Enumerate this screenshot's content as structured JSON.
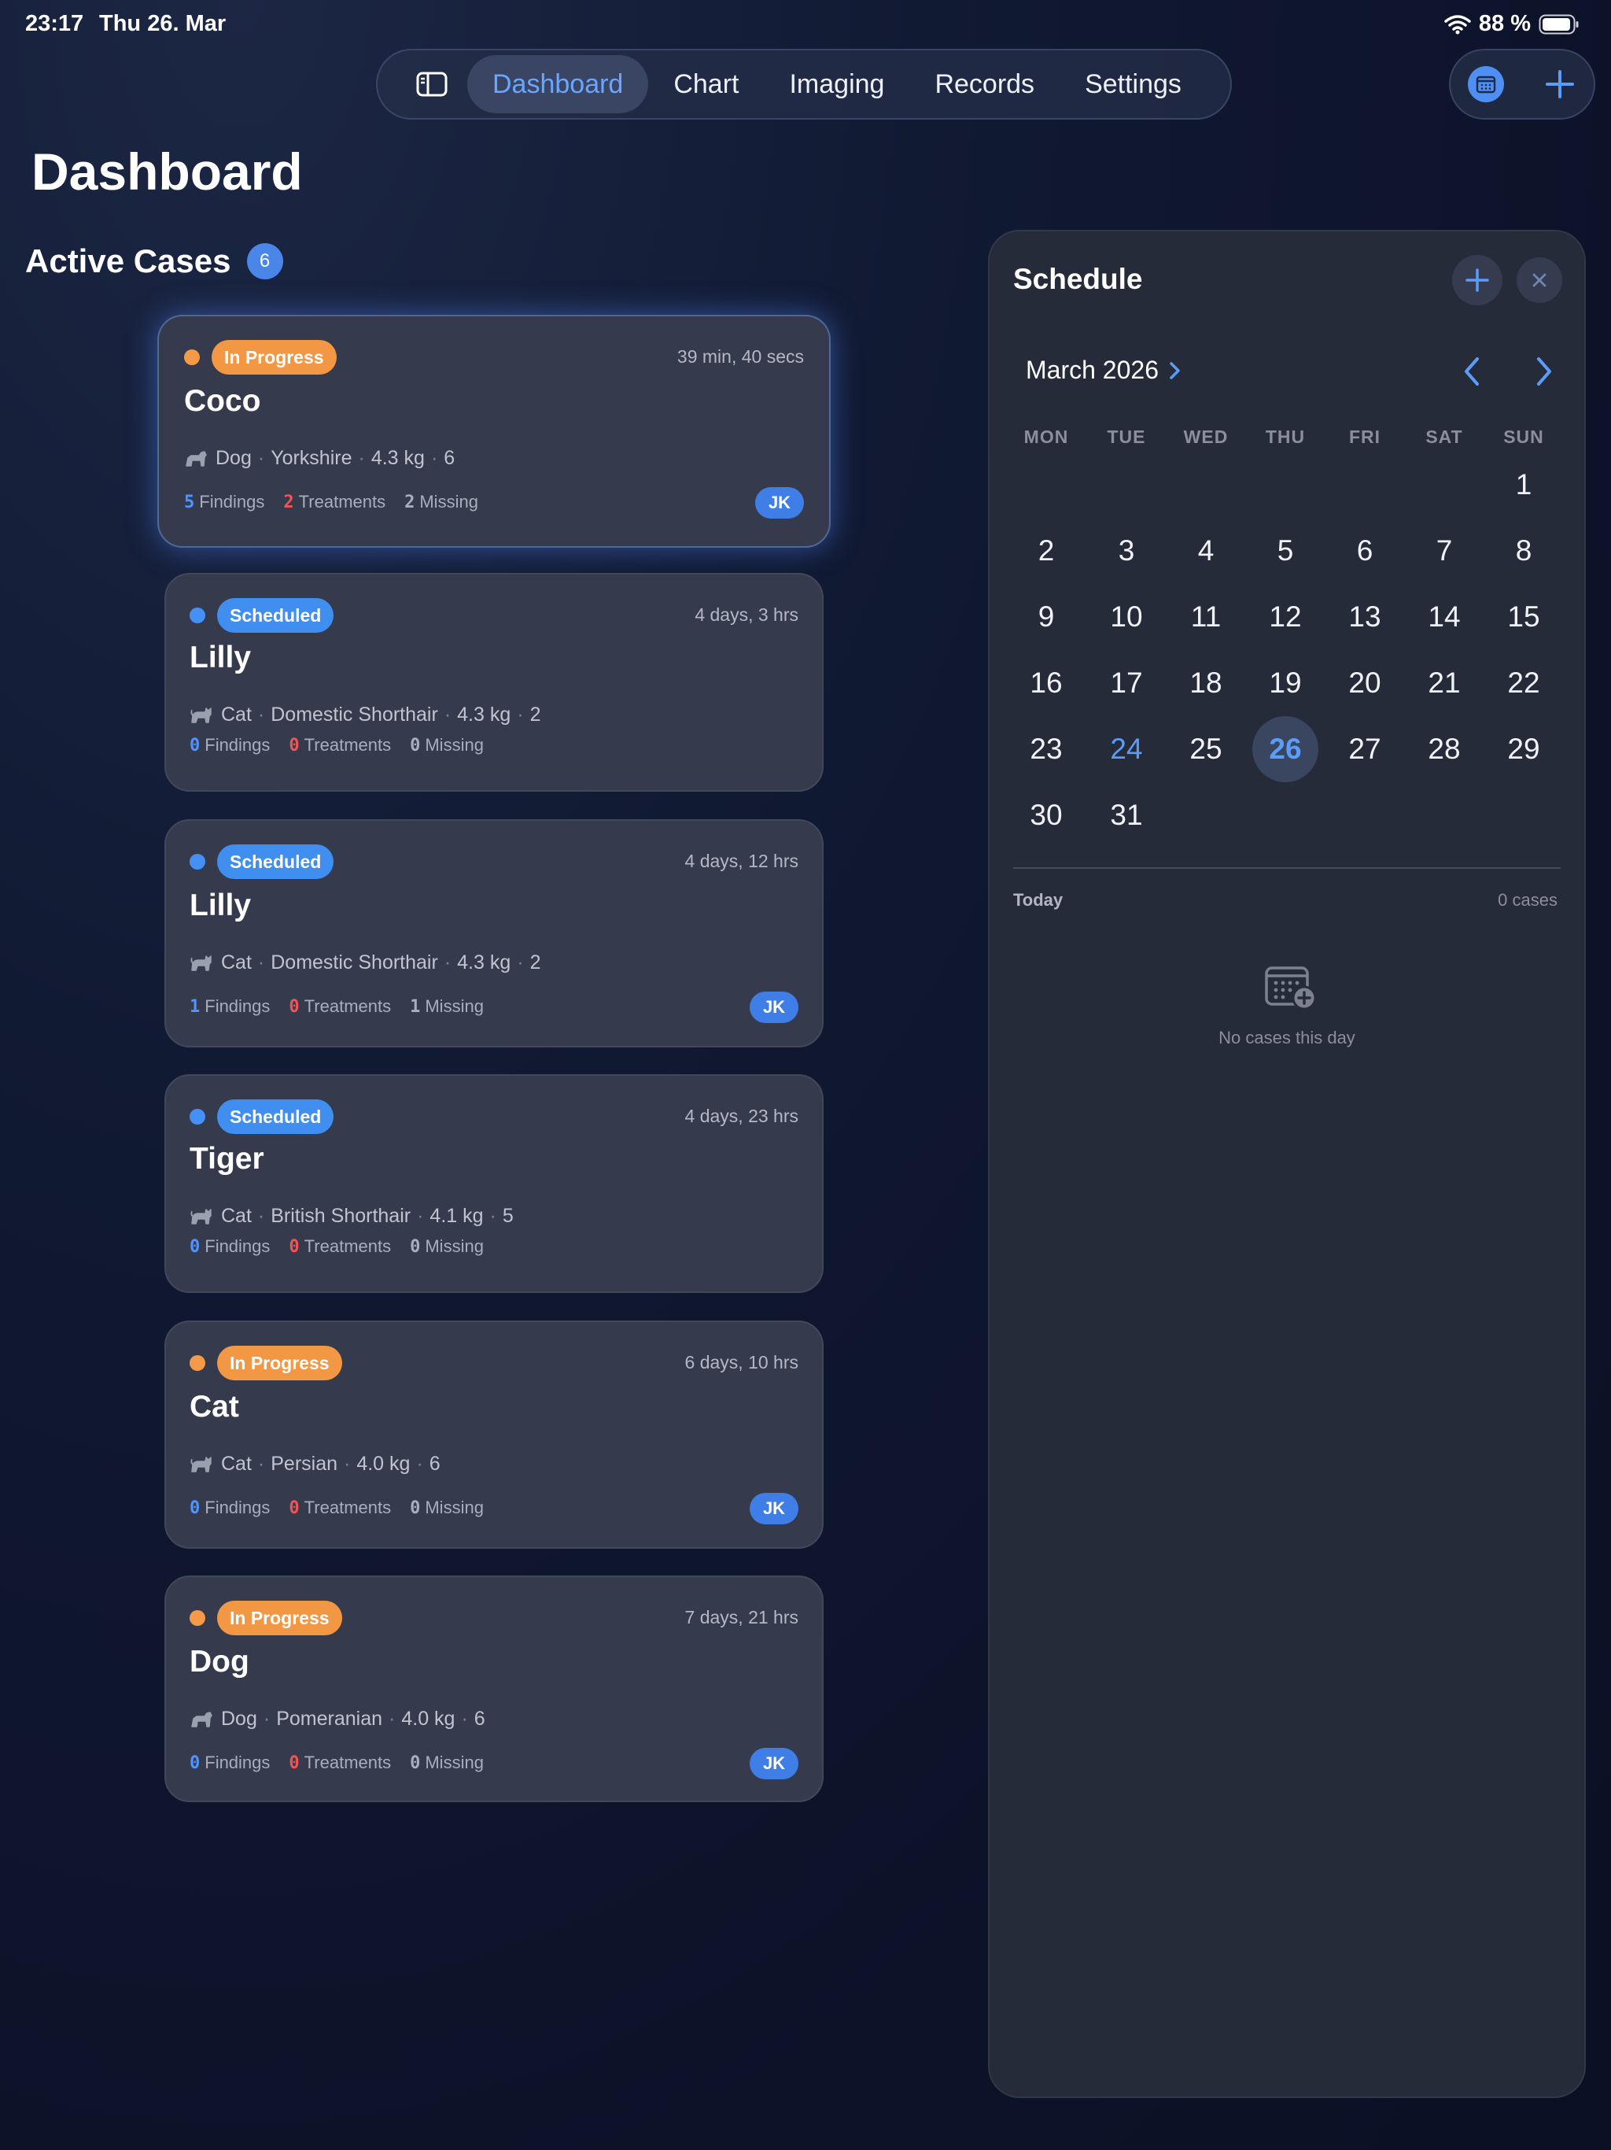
{
  "status_bar": {
    "time": "23:17",
    "date": "Thu 26. Mar",
    "battery": "88 %"
  },
  "nav": {
    "tabs": [
      "Dashboard",
      "Chart",
      "Imaging",
      "Records",
      "Settings"
    ],
    "active": "Dashboard"
  },
  "page_title": "Dashboard",
  "active_cases": {
    "title": "Active Cases",
    "count": "6"
  },
  "cases": [
    {
      "status": "In Progress",
      "time": "39 min, 40 secs",
      "name": "Coco",
      "species": "Dog",
      "breed": "Yorkshire",
      "weight": "4.3 kg",
      "age": "6",
      "findings": "5",
      "findings_label": "Findings",
      "treatments": "2",
      "treatments_label": "Treatments",
      "missing": "2",
      "missing_label": "Missing",
      "assignee": "JK"
    },
    {
      "status": "Scheduled",
      "time": "4 days, 3 hrs",
      "name": "Lilly",
      "species": "Cat",
      "breed": "Domestic Shorthair",
      "weight": "4.3 kg",
      "age": "2",
      "findings": "0",
      "findings_label": "Findings",
      "treatments": "0",
      "treatments_label": "Treatments",
      "missing": "0",
      "missing_label": "Missing",
      "assignee": ""
    },
    {
      "status": "Scheduled",
      "time": "4 days, 12 hrs",
      "name": "Lilly",
      "species": "Cat",
      "breed": "Domestic Shorthair",
      "weight": "4.3 kg",
      "age": "2",
      "findings": "1",
      "findings_label": "Findings",
      "treatments": "0",
      "treatments_label": "Treatments",
      "missing": "1",
      "missing_label": "Missing",
      "assignee": "JK"
    },
    {
      "status": "Scheduled",
      "time": "4 days, 23 hrs",
      "name": "Tiger",
      "species": "Cat",
      "breed": "British Shorthair",
      "weight": "4.1 kg",
      "age": "5",
      "findings": "0",
      "findings_label": "Findings",
      "treatments": "0",
      "treatments_label": "Treatments",
      "missing": "0",
      "missing_label": "Missing",
      "assignee": ""
    },
    {
      "status": "In Progress",
      "time": "6 days, 10 hrs",
      "name": "Cat",
      "species": "Cat",
      "breed": "Persian",
      "weight": "4.0 kg",
      "age": "6",
      "findings": "0",
      "findings_label": "Findings",
      "treatments": "0",
      "treatments_label": "Treatments",
      "missing": "0",
      "missing_label": "Missing",
      "assignee": "JK"
    },
    {
      "status": "In Progress",
      "time": "7 days, 21 hrs",
      "name": "Dog",
      "species": "Dog",
      "breed": "Pomeranian",
      "weight": "4.0 kg",
      "age": "6",
      "findings": "0",
      "findings_label": "Findings",
      "treatments": "0",
      "treatments_label": "Treatments",
      "missing": "0",
      "missing_label": "Missing",
      "assignee": "JK"
    }
  ],
  "schedule": {
    "title": "Schedule",
    "month": "March 2026",
    "weekdays": [
      "MON",
      "TUE",
      "WED",
      "THU",
      "FRI",
      "SAT",
      "SUN"
    ],
    "first_weekday_index": 6,
    "days_in_month": 31,
    "selected_day": "26",
    "highlight_day": "24",
    "today_label": "Today",
    "cases_count": "0 cases",
    "empty_text": "No cases this day"
  },
  "colors": {
    "accent": "#4f8ef2",
    "in_progress": "#f29845",
    "scheduled": "#3f8ef0",
    "findings": "#4f94ff",
    "treatments": "#f05555"
  }
}
